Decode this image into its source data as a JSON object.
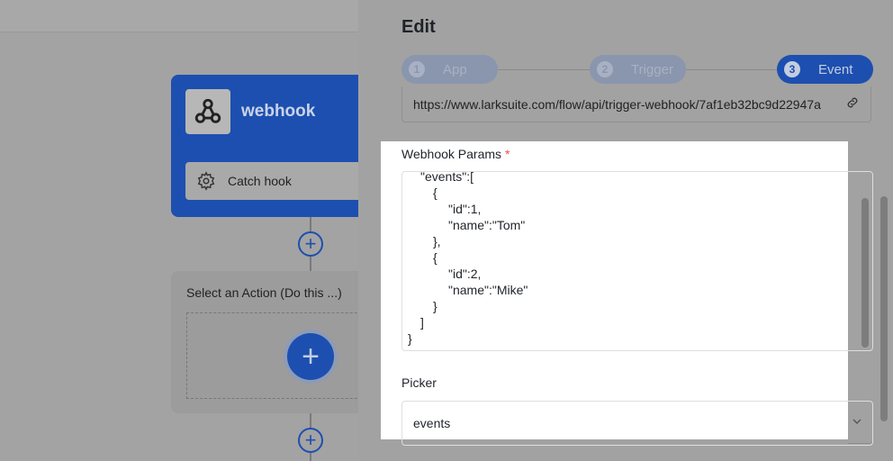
{
  "canvas": {
    "trigger": {
      "title": "webhook",
      "sub_label": "Catch hook"
    },
    "action": {
      "title": "Select an Action (Do this ...)"
    },
    "add_symbol": "+"
  },
  "drawer": {
    "title": "Edit",
    "steps": [
      {
        "num": "1",
        "label": "App",
        "state": "inactive"
      },
      {
        "num": "2",
        "label": "Trigger",
        "state": "inactive"
      },
      {
        "num": "3",
        "label": "Event",
        "state": "active"
      }
    ],
    "url": "https://www.larksuite.com/flow/api/trigger-webhook/7af1eb32bc9d22947a",
    "webhook_params": {
      "label": "Webhook Params",
      "required_mark": "*",
      "lines": [
        "\"events\":[",
        "{",
        "\"id\":1,",
        "\"name\":\"Tom\"",
        "},",
        "{",
        "\"id\":2,",
        "\"name\":\"Mike\"",
        "}",
        "]",
        "}"
      ]
    },
    "picker": {
      "label": "Picker",
      "value": "events"
    }
  },
  "colors": {
    "accent": "#1d4fb0",
    "required": "#f54a45"
  }
}
